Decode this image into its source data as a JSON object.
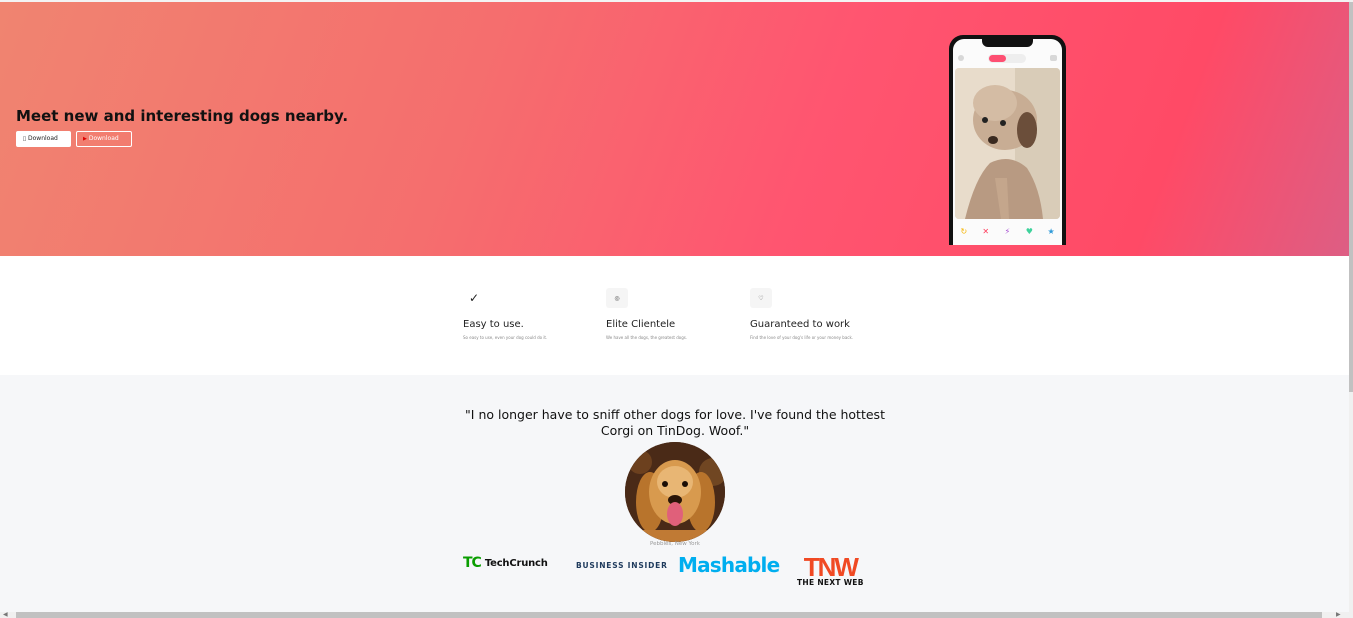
{
  "hero": {
    "title": "Meet new and interesting dogs nearby.",
    "download_apple": "Download",
    "download_google": "Download"
  },
  "phone": {
    "icons": [
      "user-icon",
      "flame-icon",
      "chat-icon",
      "undo-icon",
      "close-icon",
      "bolt-icon",
      "heart-icon",
      "star-icon"
    ]
  },
  "features": [
    {
      "icon": "check-circle-icon",
      "title": "Easy to use.",
      "text": "So easy to use, even your dog could do it."
    },
    {
      "icon": "bullseye-icon",
      "title": "Elite Clientele",
      "text": "We have all the dogs, the greatest dogs."
    },
    {
      "icon": "heart-icon",
      "title": "Guaranteed to work",
      "text": "Find the love of your dog's life or your money back."
    }
  ],
  "testimonial": {
    "quote": "\"I no longer have to sniff other dogs for love. I've found the hottest Corgi on TinDog. Woof.\"",
    "caption": "Pebbles, New York"
  },
  "press": {
    "techcrunch_mark": "TC",
    "techcrunch": "TechCrunch",
    "business_insider": "BUSINESS INSIDER",
    "mashable": "Mashable",
    "tnw": "TNW",
    "tnw_sub": "THE NEXT WEB"
  },
  "colors": {
    "hero_gradient_start": "#f08470",
    "hero_gradient_end": "#ff4a66",
    "brand_pink": "#fe4f72",
    "techcrunch_green": "#0a9e01",
    "mashable_blue": "#00aeef",
    "tnw_orange": "#f04923"
  }
}
